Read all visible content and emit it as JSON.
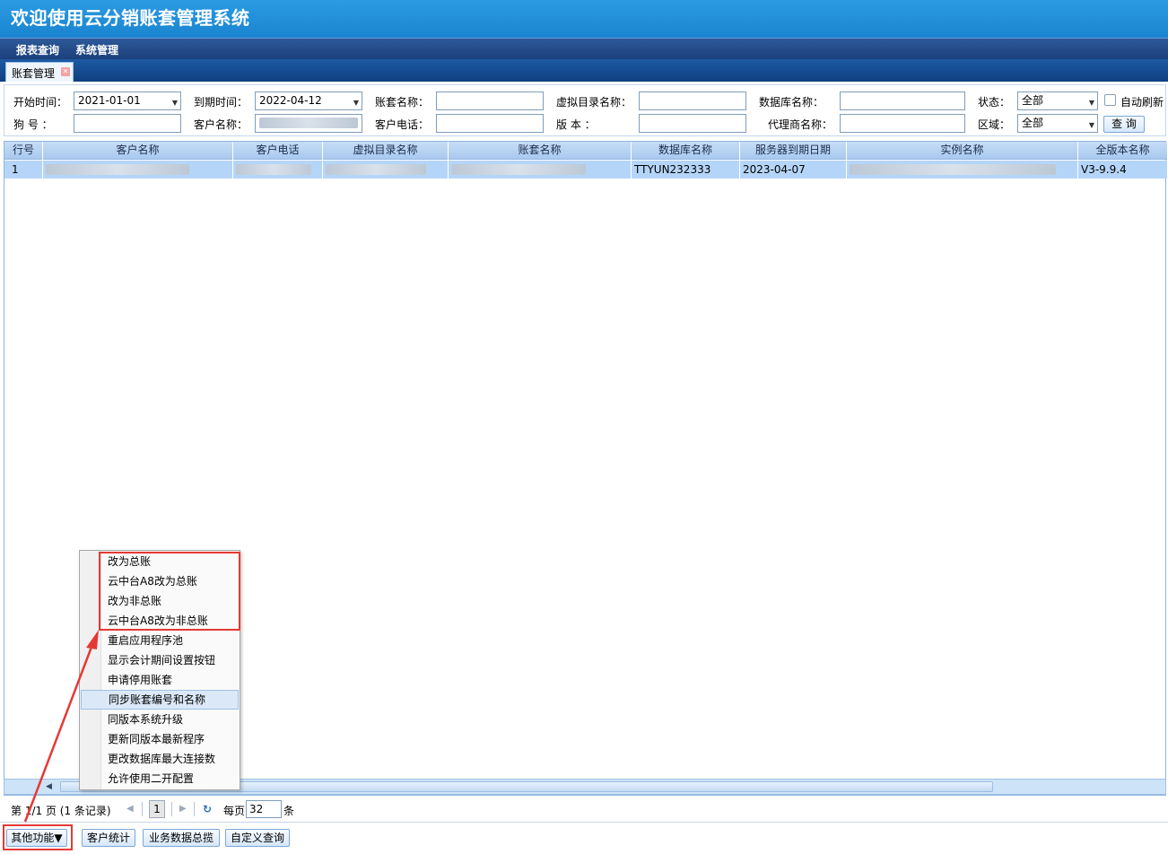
{
  "header": {
    "title": "欢迎使用云分销账套管理系统"
  },
  "menubar": {
    "items": [
      "报表查询",
      "系统管理"
    ]
  },
  "tabs": [
    {
      "label": "账套管理"
    }
  ],
  "filters": {
    "start_label": "开始时间：",
    "start_value": "2021-01-01",
    "end_label": "到期时间：",
    "end_value": "2022-04-12",
    "account_label": "账套名称：",
    "vdir_label": "虚拟目录名称：",
    "db_label": "数据库名称：",
    "status_label": "状态：",
    "status_value": "全部",
    "auto_refresh_label": "自动刷新",
    "dog_label": "狗    号   ：",
    "customer_label": "客户名称：",
    "phone_label": "客户电话：",
    "version_label": "版    本   ：",
    "agent_label": "代理商名称：",
    "region_label": "区域：",
    "region_value": "全部",
    "query_button": "查 询"
  },
  "table": {
    "columns": [
      "行号",
      "客户名称",
      "客户电话",
      "虚拟目录名称",
      "账套名称",
      "数据库名称",
      "服务器到期日期",
      "实例名称",
      "全版本名称"
    ],
    "rows": [
      {
        "row_no": "1",
        "db_name": "TTYUN232333",
        "expire_date": "2023-04-07",
        "full_version": "V3-9.9.4"
      }
    ]
  },
  "pager": {
    "page_info": "第 1/1 页 (1 条记录)",
    "current_page": "1",
    "per_page_label": "每页",
    "per_page_value": "32",
    "per_page_unit": "条"
  },
  "bottom_buttons": [
    "其他功能▼",
    "客户统计",
    "业务数据总揽",
    "自定义查询"
  ],
  "context_menu": {
    "items": [
      "改为总账",
      "云中台A8改为总账",
      "改为非总账",
      "云中台A8改为非总账",
      "重启应用程序池",
      "显示会计期间设置按钮",
      "申请停用账套",
      "同步账套编号和名称",
      "同版本系统升级",
      "更新同版本最新程序",
      "更改数据库最大连接数",
      "允许使用二开配置"
    ]
  },
  "annotation_color": "#e53935"
}
